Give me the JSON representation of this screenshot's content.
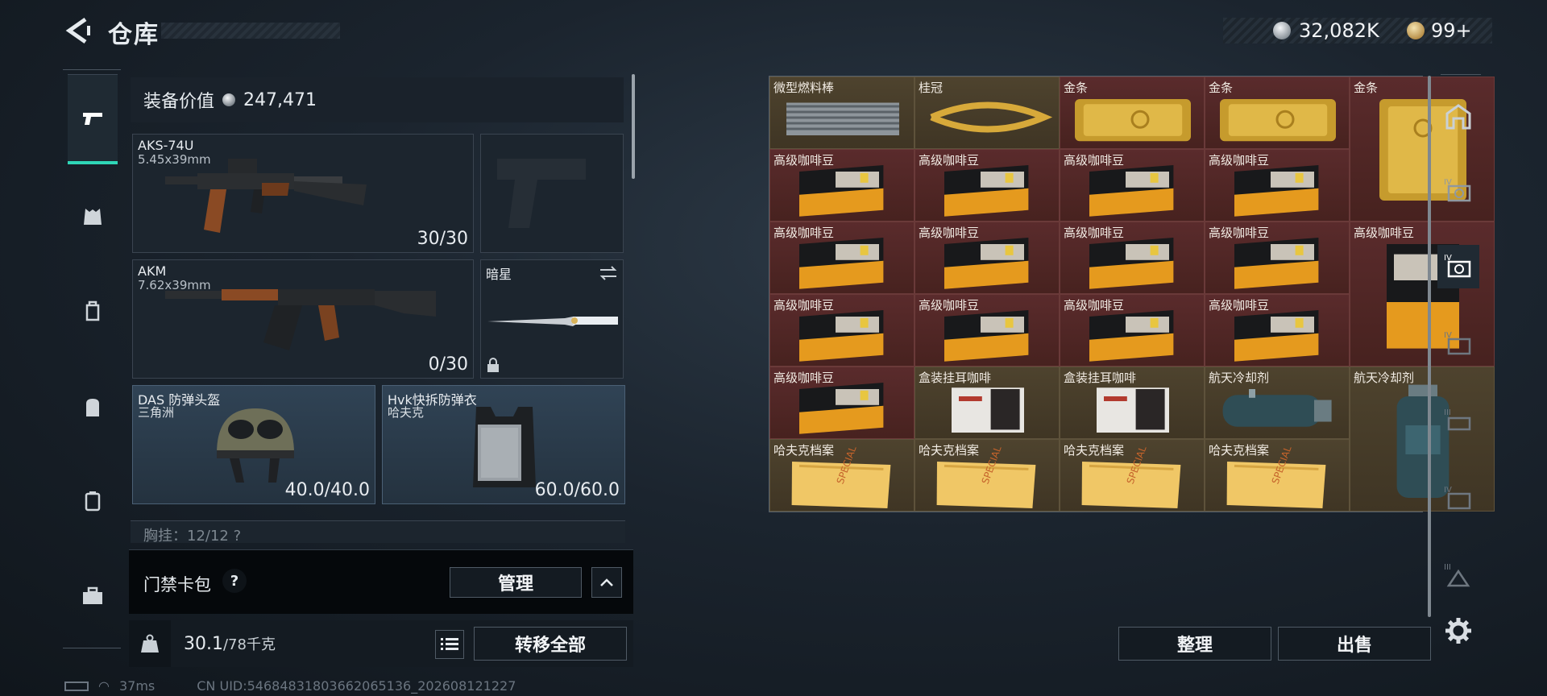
{
  "header": {
    "title": "仓库",
    "silver_amount": "32,082K",
    "gold_amount": "99+"
  },
  "left_nav": {
    "items": [
      "weapon",
      "vest",
      "backpack-outline",
      "backpack",
      "case",
      "toolbox"
    ]
  },
  "equipment": {
    "value_label": "装备价值",
    "value": "247,471",
    "primary_weapon": {
      "name": "AKS-74U",
      "caliber": "5.45x39mm",
      "ammo": "30/30"
    },
    "secondary_weapon": {
      "name": "AKM",
      "caliber": "7.62x39mm",
      "ammo": "0/30"
    },
    "pistol_slot": {
      "name": ""
    },
    "melee": {
      "name": "暗星"
    },
    "helmet": {
      "name": "DAS 防弹头盔",
      "origin": "三角洲",
      "durability": "40.0/40.0"
    },
    "armor": {
      "name": "Hvk快拆防弹衣",
      "origin": "哈夫克",
      "durability": "60.0/60.0"
    },
    "chest_rig": {
      "label": "胸挂：12/12 ? "
    }
  },
  "keycard": {
    "label": "门禁卡包",
    "help": "?",
    "manage_label": "管理"
  },
  "weight": {
    "current": "30.1",
    "max": "/78千克",
    "transfer_label": "转移全部"
  },
  "footer": {
    "ping": "37ms",
    "uid": "CN UID:5468483180366206513​6_202608121227"
  },
  "storage": {
    "items": [
      {
        "label": "微型燃料棒",
        "kind": "fuel",
        "color": "gold"
      },
      {
        "label": "桂冠",
        "kind": "laurel",
        "color": "gold"
      },
      {
        "label": "金条",
        "kind": "goldbar",
        "color": "red"
      },
      {
        "label": "金条",
        "kind": "goldbar",
        "color": "red"
      },
      {
        "label": "金条",
        "kind": "goldbar-v",
        "color": "red"
      },
      {
        "label": "高级咖啡豆",
        "kind": "coffee",
        "color": "red"
      },
      {
        "label": "高级咖啡豆",
        "kind": "coffee",
        "color": "red"
      },
      {
        "label": "高级咖啡豆",
        "kind": "coffee",
        "color": "red"
      },
      {
        "label": "高级咖啡豆",
        "kind": "coffee",
        "color": "red"
      },
      {
        "label": "高级咖啡豆",
        "kind": "coffee",
        "color": "red"
      },
      {
        "label": "高级咖啡豆",
        "kind": "coffee",
        "color": "red"
      },
      {
        "label": "高级咖啡豆",
        "kind": "coffee",
        "color": "red"
      },
      {
        "label": "高级咖啡豆",
        "kind": "coffee",
        "color": "red"
      },
      {
        "label": "高级咖啡豆",
        "kind": "coffee-v",
        "color": "red"
      },
      {
        "label": "高级咖啡豆",
        "kind": "coffee",
        "color": "red"
      },
      {
        "label": "高级咖啡豆",
        "kind": "coffee",
        "color": "red"
      },
      {
        "label": "高级咖啡豆",
        "kind": "coffee",
        "color": "red"
      },
      {
        "label": "高级咖啡豆",
        "kind": "coffee",
        "color": "red"
      },
      {
        "label": "高级咖啡豆",
        "kind": "coffee",
        "color": "red"
      },
      {
        "label": "盒装挂耳咖啡",
        "kind": "box",
        "color": "gold"
      },
      {
        "label": "盒装挂耳咖啡",
        "kind": "box",
        "color": "gold"
      },
      {
        "label": "航天冷却剂",
        "kind": "coolant",
        "color": "gold"
      },
      {
        "label": "航天冷却剂",
        "kind": "coolant-v",
        "color": "gold"
      },
      {
        "label": "哈夫克档案",
        "kind": "file",
        "color": "gold"
      },
      {
        "label": "哈夫克档案",
        "kind": "file",
        "color": "gold"
      },
      {
        "label": "哈夫克档案",
        "kind": "file",
        "color": "gold"
      },
      {
        "label": "哈夫克档案",
        "kind": "file",
        "color": "gold"
      }
    ],
    "sort_label": "整理",
    "sell_label": "出售"
  },
  "right_nav": {
    "items": [
      "home",
      "IV",
      "IV",
      "IV",
      "III",
      "IV",
      "III",
      "settings"
    ]
  }
}
